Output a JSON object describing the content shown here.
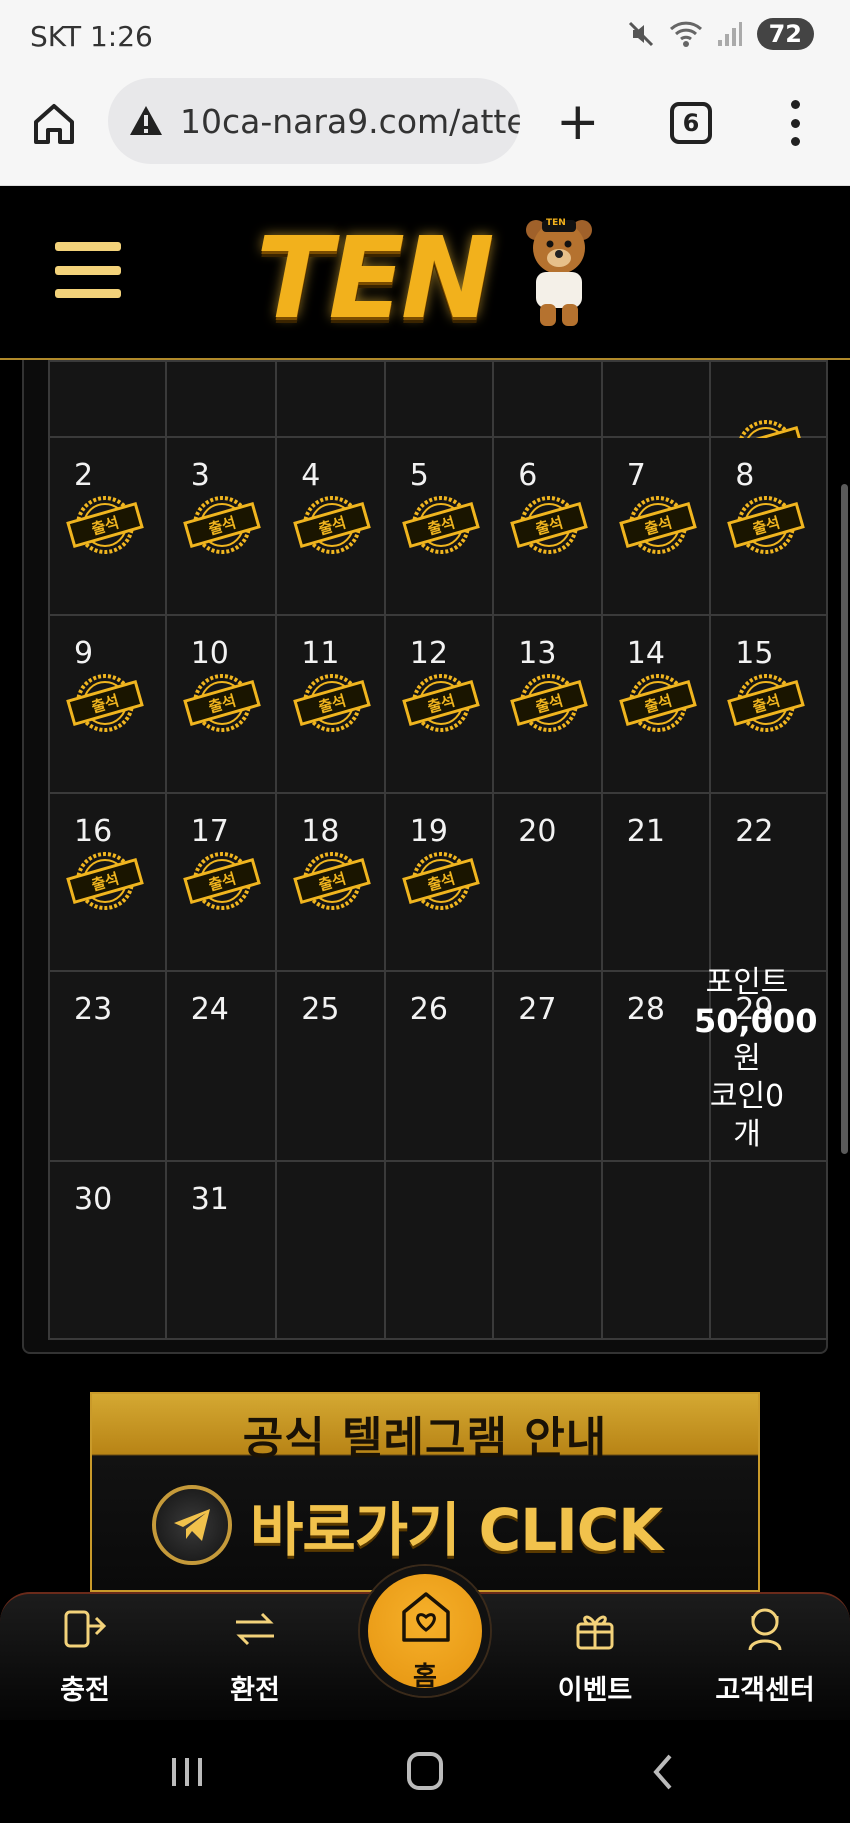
{
  "status_bar": {
    "carrier_time": "SKT 1:26",
    "battery": "72"
  },
  "browser": {
    "url": "10ca-nara9.com/atte",
    "tab_count": "6"
  },
  "site": {
    "logo_text": "TEN",
    "bear_badge": "TEN"
  },
  "calendar": {
    "stamp_text": "출석",
    "weeks": [
      [
        {
          "day": "",
          "stamp": false
        },
        {
          "day": "",
          "stamp": false
        },
        {
          "day": "",
          "stamp": false
        },
        {
          "day": "",
          "stamp": false
        },
        {
          "day": "",
          "stamp": false
        },
        {
          "day": "",
          "stamp": false
        },
        {
          "day": "",
          "stamp": true
        }
      ],
      [
        {
          "day": "2",
          "stamp": true
        },
        {
          "day": "3",
          "stamp": true
        },
        {
          "day": "4",
          "stamp": true
        },
        {
          "day": "5",
          "stamp": true
        },
        {
          "day": "6",
          "stamp": true
        },
        {
          "day": "7",
          "stamp": true
        },
        {
          "day": "8",
          "stamp": true
        }
      ],
      [
        {
          "day": "9",
          "stamp": true
        },
        {
          "day": "10",
          "stamp": true
        },
        {
          "day": "11",
          "stamp": true
        },
        {
          "day": "12",
          "stamp": true
        },
        {
          "day": "13",
          "stamp": true
        },
        {
          "day": "14",
          "stamp": true
        },
        {
          "day": "15",
          "stamp": true
        }
      ],
      [
        {
          "day": "16",
          "stamp": true
        },
        {
          "day": "17",
          "stamp": true
        },
        {
          "day": "18",
          "stamp": true
        },
        {
          "day": "19",
          "stamp": true
        },
        {
          "day": "20",
          "stamp": false
        },
        {
          "day": "21",
          "stamp": false
        },
        {
          "day": "22",
          "stamp": false
        }
      ],
      [
        {
          "day": "23",
          "stamp": false
        },
        {
          "day": "24",
          "stamp": false
        },
        {
          "day": "25",
          "stamp": false
        },
        {
          "day": "26",
          "stamp": false
        },
        {
          "day": "27",
          "stamp": false
        },
        {
          "day": "28",
          "stamp": false
        },
        {
          "day": "29",
          "stamp": false
        }
      ],
      [
        {
          "day": "30",
          "stamp": false
        },
        {
          "day": "31",
          "stamp": false
        },
        {
          "day": "",
          "stamp": false
        },
        {
          "day": "",
          "stamp": false
        },
        {
          "day": "",
          "stamp": false
        },
        {
          "day": "",
          "stamp": false
        },
        {
          "day": "",
          "stamp": false
        }
      ]
    ],
    "tooltip": {
      "line1": "포인트",
      "amount": "50,000",
      "line3": "원",
      "line4": "코인0",
      "line5": "개"
    }
  },
  "banner": {
    "title": "공식 텔레그램 안내",
    "cta": "바로가기 CLICK"
  },
  "bottom_nav": {
    "items": [
      {
        "label": "충전",
        "icon": "deposit-icon"
      },
      {
        "label": "환전",
        "icon": "exchange-icon"
      },
      {
        "label": "이벤트",
        "icon": "gift-icon"
      },
      {
        "label": "고객센터",
        "icon": "support-icon"
      }
    ],
    "home_label": "홈"
  },
  "colors": {
    "gold": "#f2b11c",
    "accent": "#e59410",
    "background": "#000000",
    "cell": "#151515"
  }
}
